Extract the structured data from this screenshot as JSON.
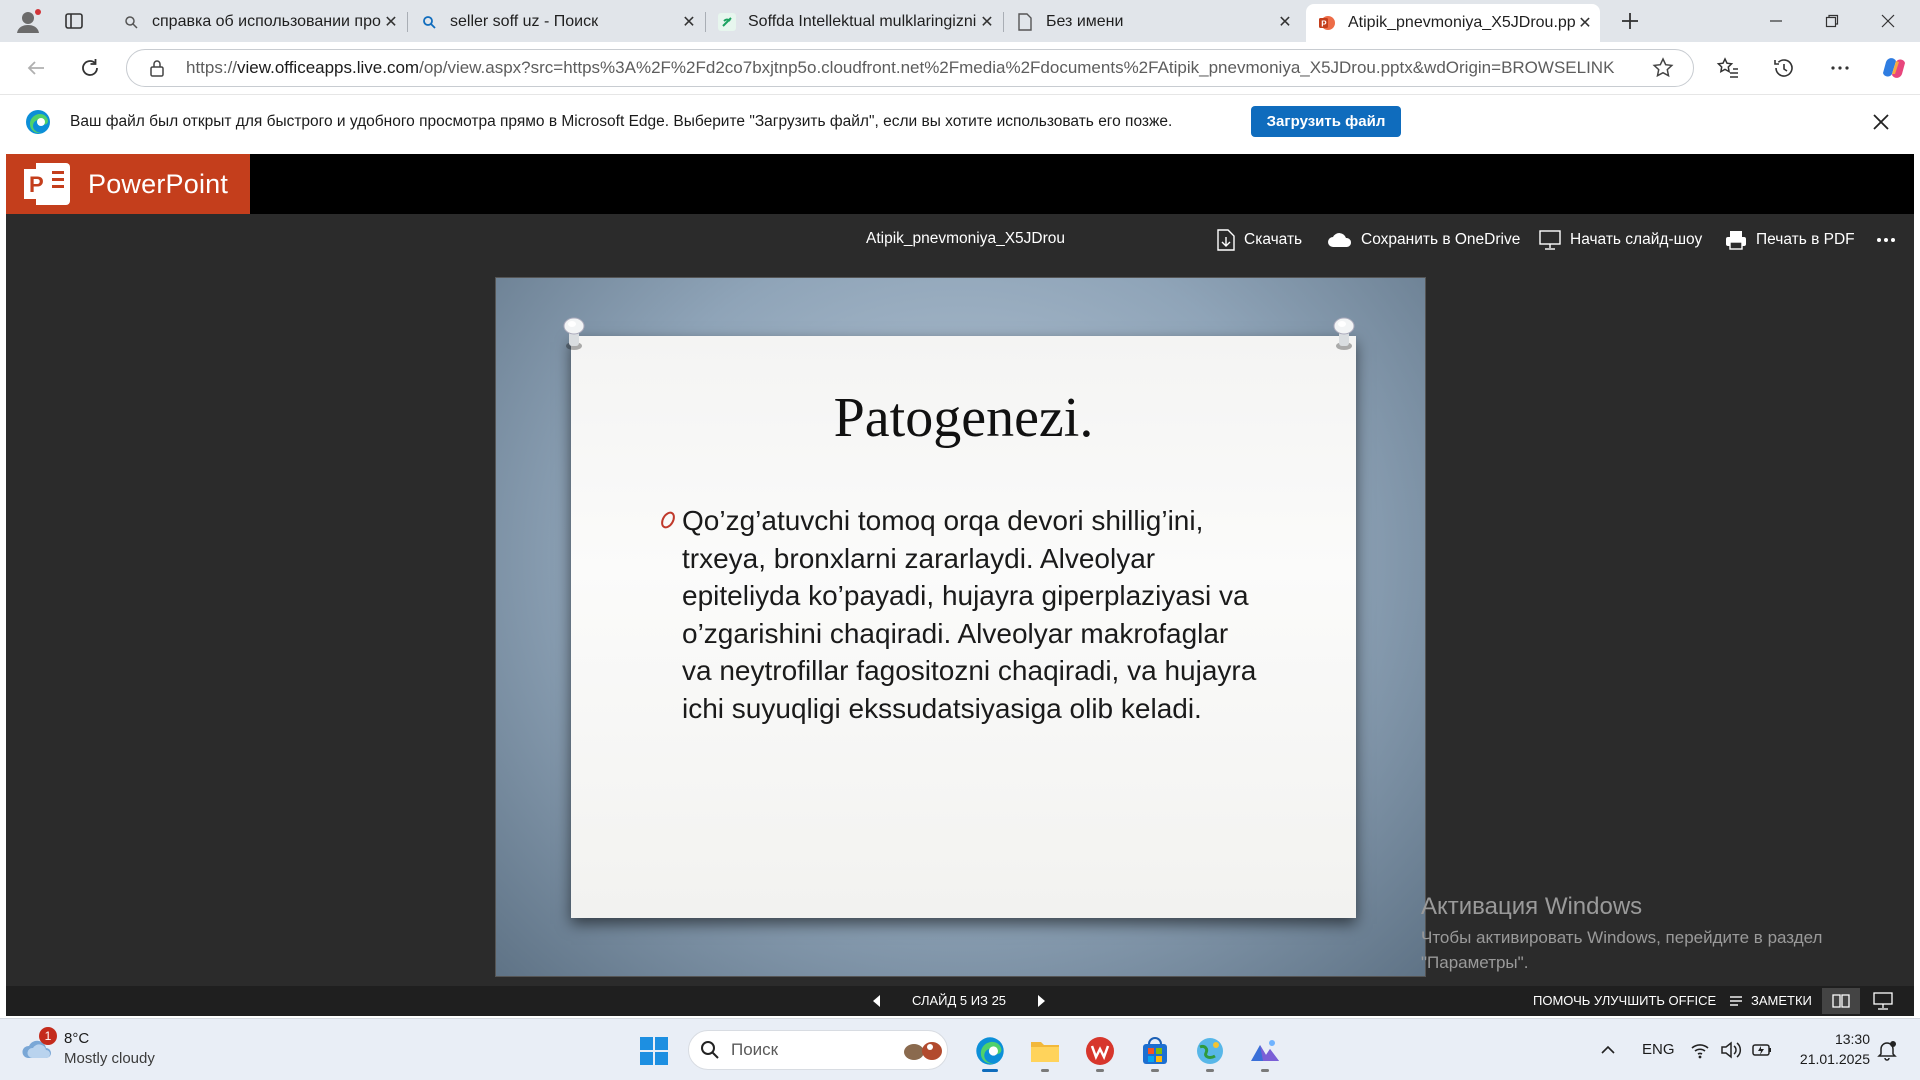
{
  "browser": {
    "tabs": [
      {
        "title": "справка об использовании про",
        "icon": "search-icon",
        "active": false
      },
      {
        "title": "seller soff uz - Поиск",
        "icon": "search-icon",
        "active": false
      },
      {
        "title": "Soffda Intellektual mulklaringizni",
        "icon": "soff-favicon-icon",
        "active": false
      },
      {
        "title": "Без имени",
        "icon": "blank-page-icon",
        "active": false
      },
      {
        "title": "Atipik_pnevmoniya_X5JDrou.pptx",
        "icon": "powerpoint-favicon-icon",
        "active": true
      }
    ],
    "url_prefix": "https://",
    "url_host": "view.officeapps.live.com",
    "url_rest": "/op/view.aspx?src=https%3A%2F%2Fd2co7bxjtnp5o.cloudfront.net%2Fmedia%2Fdocuments%2FAtipik_pnevmoniya_X5JDrou.pptx&wdOrigin=BROWSELINK",
    "infobar_text": "Ваш файл был открыт для быстрого и удобного просмотра прямо в Microsoft Edge. Выберите \"Загрузить файл\", если вы хотите использовать его позже.",
    "infobar_button": "Загрузить файл"
  },
  "viewer": {
    "app_name": "PowerPoint",
    "doc_name": "Atipik_pnevmoniya_X5JDrou",
    "commands": {
      "download": "Скачать",
      "save_onedrive": "Сохранить в OneDrive",
      "slideshow": "Начать слайд-шоу",
      "print_pdf": "Печать в PDF"
    },
    "slide": {
      "title": "Patogenezi.",
      "body": "Qo’zg’atuvchi tomoq orqa devori shillig’ini, trxeya, bronxlarni zararlaydi. Alveolyar epiteliyda ko’payadi, hujayra giperplaziyasi va o’zgarishini chaqiradi. Alveolyar makrofaglar va neytrofillar fagositozni chaqiradi, va hujayra ichi suyuqligi ekssudatsiyasiga olib keladi."
    },
    "status": {
      "slide_counter": "СЛАЙД 5 ИЗ 25",
      "help_improve": "ПОМОЧЬ УЛУЧШИТЬ OFFICE",
      "notes": "ЗАМЕТКИ"
    }
  },
  "watermark": {
    "title": "Активация Windows",
    "subtitle": "Чтобы активировать Windows, перейдите в раздел \"Параметры\"."
  },
  "taskbar": {
    "weather_temp": "8°C",
    "weather_desc": "Mostly cloudy",
    "weather_badge": "1",
    "search_placeholder": "Поиск",
    "language": "ENG",
    "time": "13:30",
    "date": "21.01.2025"
  },
  "colors": {
    "powerpoint_brand": "#c43e1c",
    "edge_accent": "#0f6cbd",
    "viewer_bg": "#2b2b2b"
  }
}
